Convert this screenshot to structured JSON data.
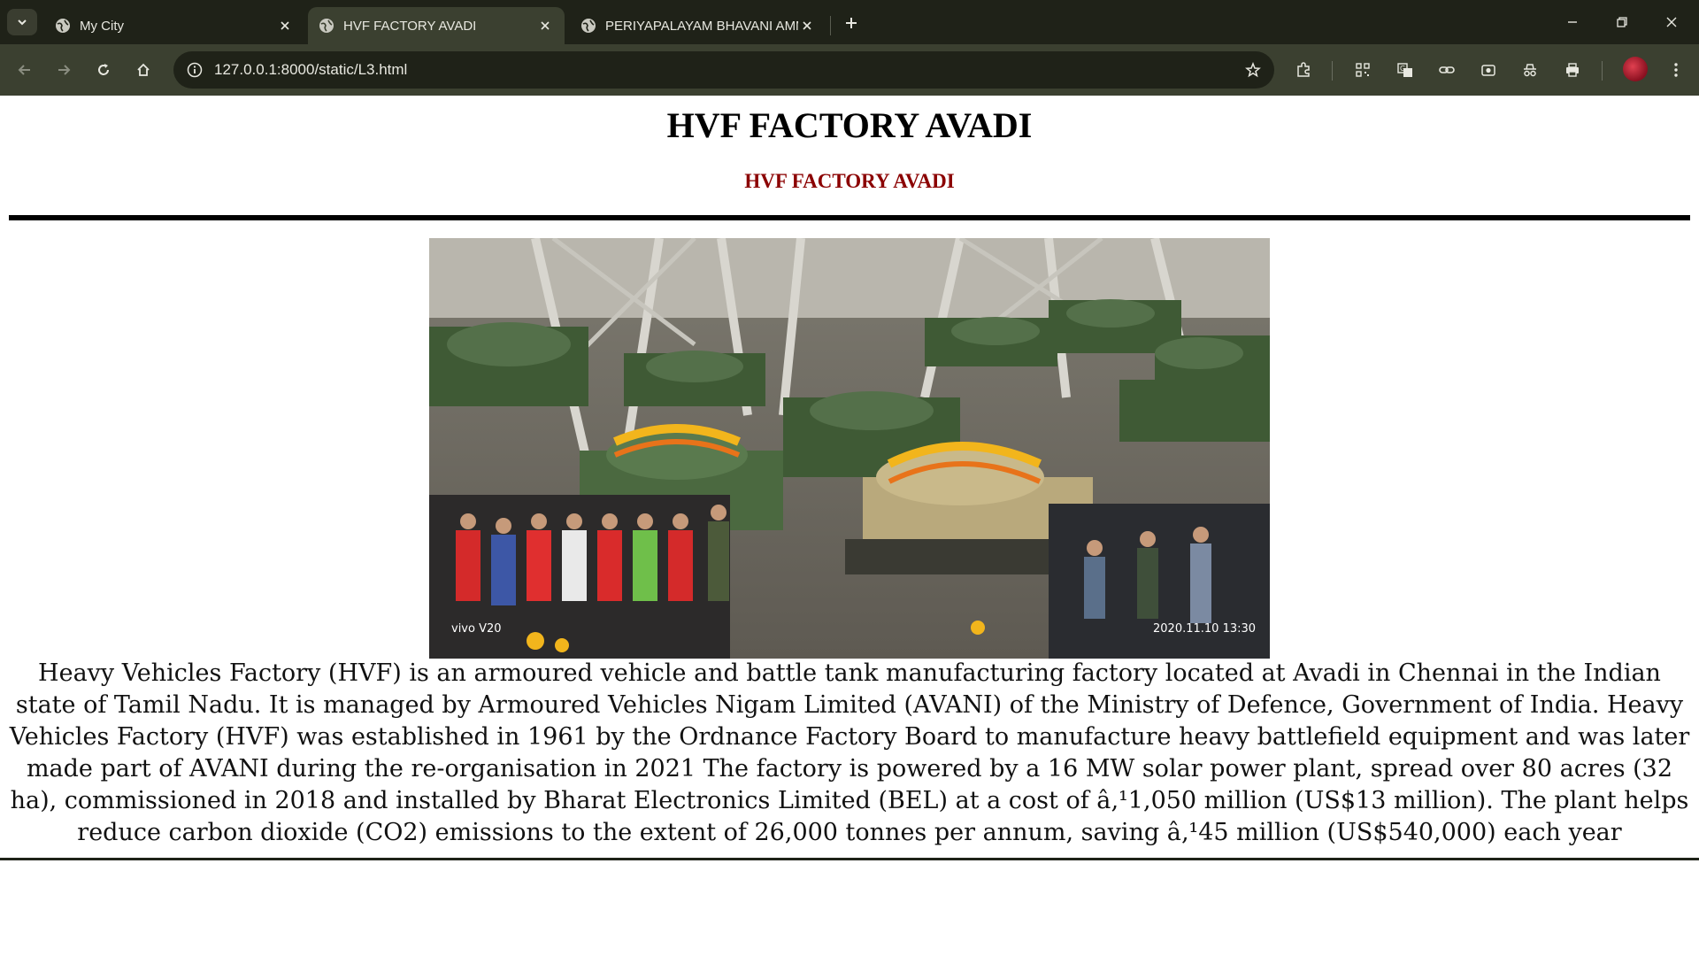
{
  "browser": {
    "tabs": [
      {
        "title": "My City",
        "active": false
      },
      {
        "title": "HVF FACTORY AVADI",
        "active": true
      },
      {
        "title": "PERIYAPALAYAM BHAVANI AMMAN",
        "active": false
      }
    ],
    "url": "127.0.0.1:8000/static/L3.html",
    "icons": {
      "tab_search": "chevron-down-icon",
      "new_tab": "plus-icon",
      "back": "arrow-left-icon",
      "forward": "arrow-right-icon",
      "reload": "reload-icon",
      "home": "home-icon",
      "site_info": "info-icon",
      "bookmark": "star-icon",
      "extensions": "puzzle-icon",
      "qr": "qr-code-icon",
      "translate": "translate-icon",
      "link": "link-icon",
      "screenshot": "camera-icon",
      "incognito": "incognito-icon",
      "print": "print-icon",
      "menu": "kebab-menu-icon"
    }
  },
  "page": {
    "heading": "HVF FACTORY AVADI",
    "subheading": "HVF FACTORY AVADI",
    "photo": {
      "alt": "Tanks decorated with flower garlands inside the Heavy Vehicles Factory hall with workers and soldiers",
      "caption_left": "vivo V20",
      "caption_right": "2020.11.10 13:30"
    },
    "paragraph": "Heavy Vehicles Factory (HVF) is an armoured vehicle and battle tank manufacturing factory located at Avadi in Chennai in the Indian state of Tamil Nadu. It is managed by Armoured Vehicles Nigam Limited (AVANI) of the Ministry of Defence, Government of India. Heavy Vehicles Factory (HVF) was established in 1961 by the Ordnance Factory Board to manufacture heavy battlefield equipment and was later made part of AVANI during the re-organisation in 2021 The factory is powered by a 16 MW solar power plant, spread over 80 acres (32 ha), commissioned in 2018 and installed by Bharat Electronics Limited (BEL) at a cost of â‚¹1,050 million (US$13 million). The plant helps reduce carbon dioxide (CO2) emissions to the extent of 26,000 tonnes per annum, saving â‚¹45 million (US$540,000) each year"
  },
  "colors": {
    "tabstrip": "#1f2218",
    "toolbar": "#3b4030",
    "subheading": "#8b0000"
  }
}
